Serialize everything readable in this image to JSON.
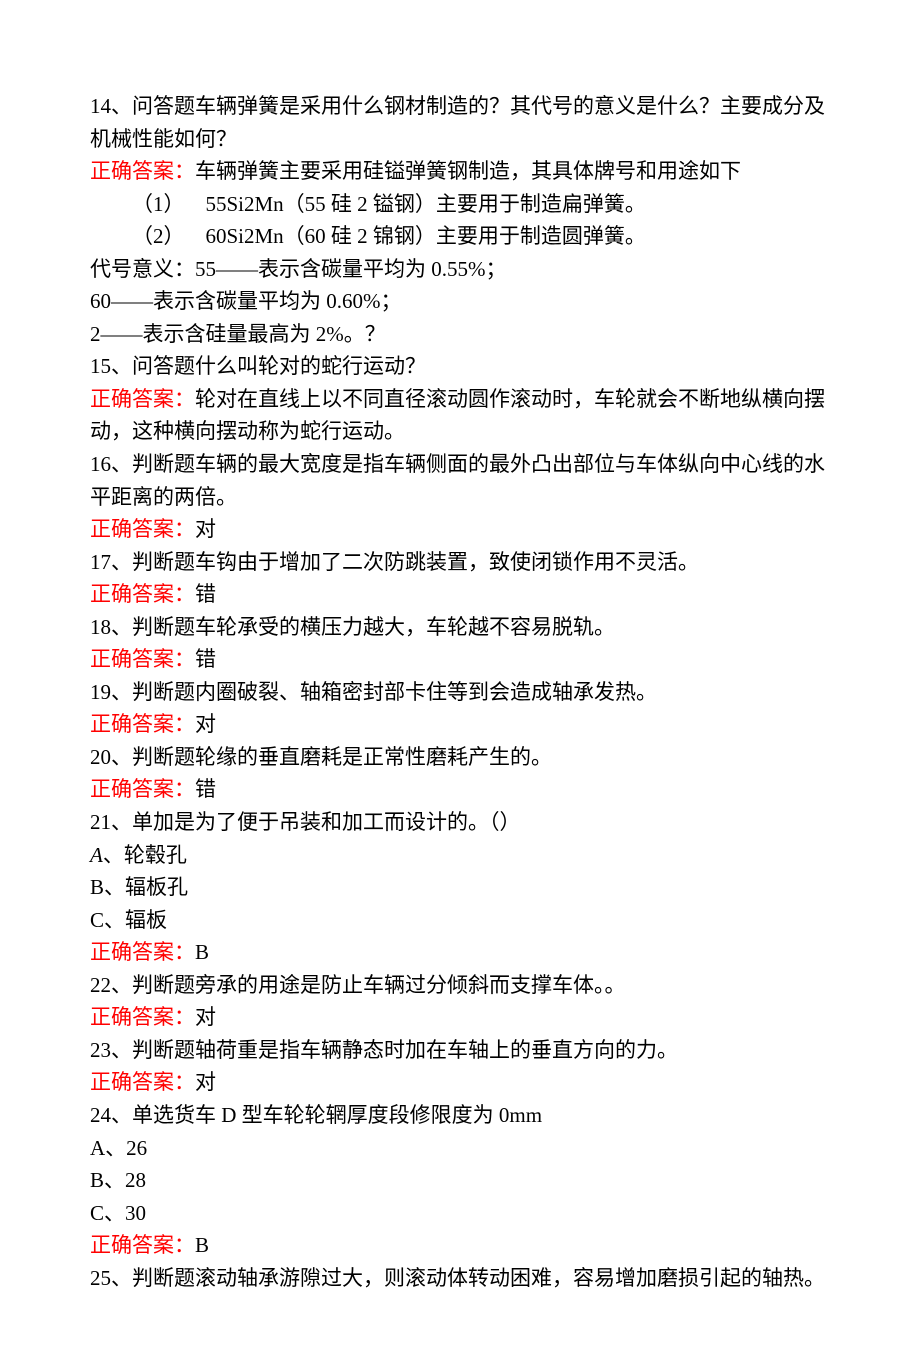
{
  "q14": {
    "prompt": "14、问答题车辆弹簧是采用什么钢材制造的？其代号的意义是什么？主要成分及机械性能如何？",
    "answer_label": "正确答案：",
    "answer_text": "车辆弹簧主要采用硅镒弹簧钢制造，其具体牌号和用途如下",
    "item1_prefix": "（1）",
    "item1_body": "55Si2Mn（55 硅 2 镒钢）主要用于制造扁弹簧。",
    "item2_prefix": "（2）",
    "item2_body": "60Si2Mn（60 硅 2 锦钢）主要用于制造圆弹簧。",
    "line_a": "代号意义：55——表示含碳量平均为 0.55%；",
    "line_b": "60——表示含碳量平均为 0.60%；",
    "line_c": "2——表示含硅量最高为 2%。？"
  },
  "q15": {
    "prompt": "15、问答题什么叫轮对的蛇行运动？",
    "answer_label": "正确答案：",
    "answer_text": "轮对在直线上以不同直径滚动圆作滚动时，车轮就会不断地纵横向摆动，这种横向摆动称为蛇行运动。"
  },
  "q16": {
    "prompt": "16、判断题车辆的最大宽度是指车辆侧面的最外凸出部位与车体纵向中心线的水平距离的两倍。",
    "answer_label": "正确答案：",
    "answer_text": "对"
  },
  "q17": {
    "prompt": "17、判断题车钩由于增加了二次防跳装置，致使闭锁作用不灵活。",
    "answer_label": "正确答案：",
    "answer_text": "错"
  },
  "q18": {
    "prompt": "18、判断题车轮承受的横压力越大，车轮越不容易脱轨。",
    "answer_label": "正确答案：",
    "answer_text": "错"
  },
  "q19": {
    "prompt": "19、判断题内圈破裂、轴箱密封部卡住等到会造成轴承发热。",
    "answer_label": "正确答案：",
    "answer_text": "对"
  },
  "q20": {
    "prompt": "20、判断题轮缘的垂直磨耗是正常性磨耗产生的。",
    "answer_label": "正确答案：",
    "answer_text": "错"
  },
  "q21": {
    "prompt": "21、单加是为了便于吊装和加工而设计的。（）",
    "option_a_prefix": "A",
    "option_a_body": "、轮毂孔",
    "option_b": "B、辐板孔",
    "option_c": "C、辐板",
    "answer_label": "正确答案：",
    "answer_text": "B"
  },
  "q22": {
    "prompt": "22、判断题旁承的用途是防止车辆过分倾斜而支撑车体。。",
    "answer_label": "正确答案：",
    "answer_text": "对"
  },
  "q23": {
    "prompt": "23、判断题轴荷重是指车辆静态时加在车轴上的垂直方向的力。",
    "answer_label": "正确答案：",
    "answer_text": "对"
  },
  "q24": {
    "prompt": "24、单选货车 D 型车轮轮辋厚度段修限度为 0mm",
    "option_a": "A、26",
    "option_b": "B、28",
    "option_c": "C、30",
    "answer_label": "正确答案：",
    "answer_text": "B"
  },
  "q25": {
    "prompt": "25、判断题滚动轴承游隙过大，则滚动体转动困难，容易增加磨损引起的轴热。"
  }
}
